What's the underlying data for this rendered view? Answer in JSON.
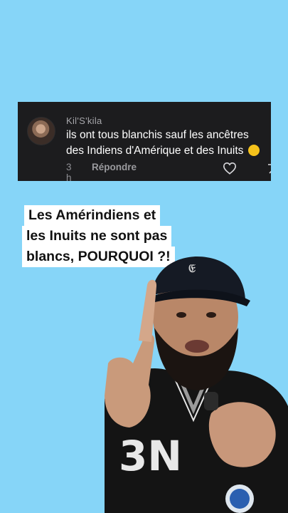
{
  "comment": {
    "username": "Kil'S'kila",
    "text_line1": "ils ont tous blanchis sauf les ancêtres",
    "text_line2": "des Indiens d'Amérique et des Inuits",
    "time": "3 h",
    "reply_label": "Répondre",
    "emoji": "thinking-face"
  },
  "caption": {
    "line1": "Les Amérindiens et",
    "line2": "les Inuits ne sont pas",
    "line3": "blancs, POURQUOI ?!"
  },
  "colors": {
    "background": "#86d5f8",
    "card": "#1c1c1e",
    "username": "#a7a7ab",
    "meta": "#8e8e93",
    "caption_bg": "#ffffff"
  }
}
